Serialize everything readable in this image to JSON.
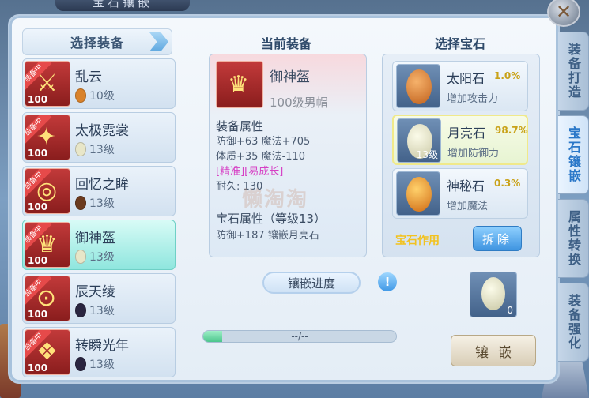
{
  "window_title": "宝石镶嵌",
  "close_label": "✕",
  "side_tabs": [
    {
      "label": "装备打造",
      "active": false
    },
    {
      "label": "宝石镶嵌",
      "active": true
    },
    {
      "label": "属性转换",
      "active": false
    },
    {
      "label": "装备强化",
      "active": false
    }
  ],
  "equip_panel": {
    "header": "选择装备",
    "items": [
      {
        "name": "乱云",
        "level": "100",
        "badge": "装备中",
        "gem_level": "10级",
        "gem_color": "#d9822b",
        "selected": false
      },
      {
        "name": "太极霓裳",
        "level": "100",
        "badge": "装备中",
        "gem_level": "13级",
        "gem_color": "#e8e6c8",
        "selected": false
      },
      {
        "name": "回忆之眸",
        "level": "100",
        "badge": "装备中",
        "gem_level": "13级",
        "gem_color": "#6b3a1e",
        "selected": false
      },
      {
        "name": "御神盔",
        "level": "100",
        "badge": "装备中",
        "gem_level": "13级",
        "gem_color": "#e8e6c8",
        "selected": true
      },
      {
        "name": "辰天绫",
        "level": "100",
        "badge": "装备中",
        "gem_level": "13级",
        "gem_color": "#2a2540",
        "selected": false
      },
      {
        "name": "转瞬光年",
        "level": "100",
        "badge": "装备中",
        "gem_level": "13级",
        "gem_color": "#2a2540",
        "selected": false
      }
    ]
  },
  "current": {
    "title": "当前装备",
    "name": "御神盔",
    "desc": "100级男帽",
    "attr_header": "装备属性",
    "attr_lines": [
      "防御+63 魔法+705",
      "体质+35 魔法-110"
    ],
    "special": "[精准][易成长]",
    "durability": "耐久: 130",
    "gem_attr_header": "宝石属性（等级13）",
    "gem_attr_line": "防御+187 镶嵌月亮石"
  },
  "watermark": "懒淘淘",
  "gem_panel": {
    "title": "选择宝石",
    "gems": [
      {
        "name": "太阳石",
        "rate": "1.0%",
        "effect": "增加攻击力",
        "color": "#d9822b",
        "count": "",
        "selected": false
      },
      {
        "name": "月亮石",
        "rate": "98.7%",
        "effect": "增加防御力",
        "color": "#e8e6c8",
        "count": "13级",
        "selected": true
      },
      {
        "name": "神秘石",
        "rate": "0.3%",
        "effect": "增加魔法",
        "color": "#e07c2a",
        "count": "",
        "selected": false
      }
    ],
    "func_label": "宝石作用",
    "remove_label": "拆除"
  },
  "progress": {
    "label": "镶嵌进度",
    "info": "!",
    "text": "--/--",
    "fill_fraction": 0.1
  },
  "slot": {
    "count": "0",
    "gem_color": "#e8e6c8"
  },
  "inlay_label": "镶嵌"
}
